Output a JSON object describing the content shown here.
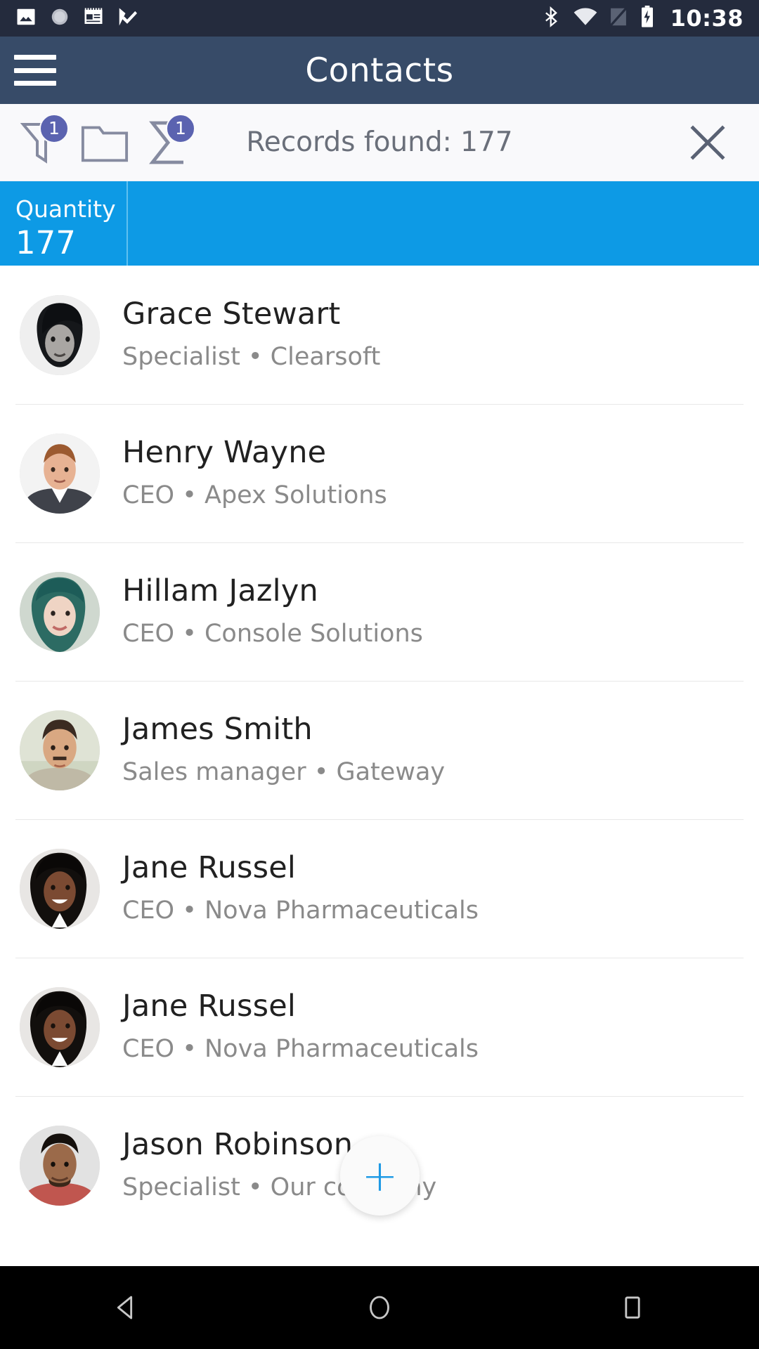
{
  "status_bar": {
    "time": "10:38",
    "left_icons": [
      "image-icon",
      "loading-spinner-icon",
      "news-calendar-icon",
      "checkmark-flag-icon"
    ],
    "right_icons": [
      "bluetooth-icon",
      "wifi-icon",
      "no-sim-icon",
      "battery-charging-icon"
    ]
  },
  "app_bar": {
    "menu_icon": "hamburger-menu-icon",
    "title": "Contacts"
  },
  "filter_bar": {
    "filter_icon": "filter-funnel-icon",
    "filter_badge": "1",
    "folder_icon": "folder-icon",
    "sum_icon": "summation-sigma-icon",
    "sum_badge": "1",
    "records_text": "Records found: 177",
    "close_icon": "close-x-icon"
  },
  "summary_bar": {
    "label": "Quantity",
    "value": "177",
    "color": "#0d9ae5"
  },
  "contacts": [
    {
      "name": "Grace Stewart",
      "role": "Specialist",
      "company": "Clearsoft",
      "separator": "•",
      "subtitle": "Specialist • Clearsoft",
      "avatar": "woman-dark-bob-hair"
    },
    {
      "name": "Henry Wayne",
      "role": "CEO",
      "company": "Apex Solutions",
      "separator": "•",
      "subtitle": "CEO • Apex Solutions",
      "avatar": "man-suit-red-hair"
    },
    {
      "name": "Hillam Jazlyn",
      "role": "CEO",
      "company": "Console Solutions",
      "separator": "•",
      "subtitle": "CEO • Console Solutions",
      "avatar": "woman-teal-hair"
    },
    {
      "name": "James Smith",
      "role": "Sales manager",
      "company": "Gateway",
      "separator": "•",
      "subtitle": "Sales manager • Gateway",
      "avatar": "man-mustache-outdoors"
    },
    {
      "name": "Jane Russel",
      "role": "CEO",
      "company": "Nova Pharmaceuticals",
      "separator": "•",
      "subtitle": "CEO • Nova Pharmaceuticals",
      "avatar": "woman-smiling-dark-hair"
    },
    {
      "name": "Jane Russel",
      "role": "CEO",
      "company": "Nova Pharmaceuticals",
      "separator": "•",
      "subtitle": "CEO • Nova Pharmaceuticals",
      "avatar": "woman-smiling-dark-hair"
    },
    {
      "name": "Jason Robinson",
      "role": "Specialist",
      "company": "Our company",
      "separator": "•",
      "subtitle": "Specialist • Our company",
      "avatar": "man-dark-hair-beard"
    }
  ],
  "fab": {
    "icon": "plus-icon",
    "label": "+",
    "color": "#1e9ae5"
  },
  "nav_bar": {
    "back_icon": "back-triangle-icon",
    "home_icon": "home-circle-icon",
    "recents_icon": "recents-square-icon"
  }
}
